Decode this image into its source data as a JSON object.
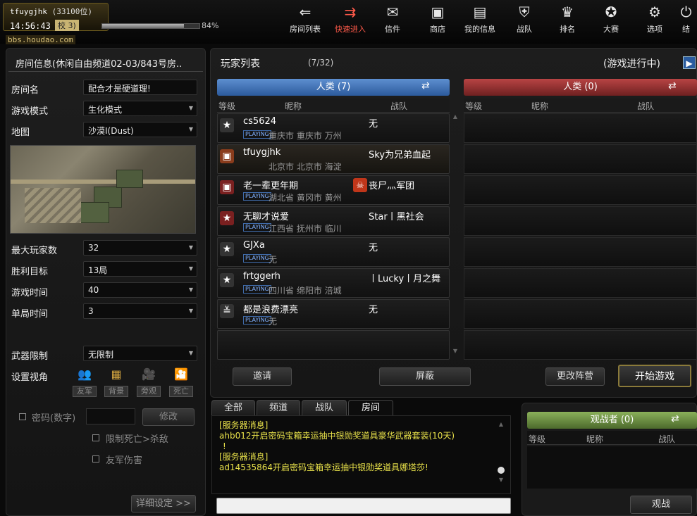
{
  "user": {
    "name": "tfuygjhk",
    "level_text": "(33100位)",
    "clock": "14:56:43",
    "badge": "校 3)",
    "exp_percent": 84,
    "exp_label": "84%",
    "site": "bbs.houdao.com"
  },
  "nav": [
    {
      "label": "房间列表",
      "icon": "back-arrow-icon"
    },
    {
      "label": "快速进入",
      "icon": "fast-forward-icon"
    },
    {
      "label": "信件",
      "icon": "mail-icon"
    },
    {
      "label": "商店",
      "icon": "shop-icon"
    },
    {
      "label": "我的信息",
      "icon": "profile-card-icon"
    },
    {
      "label": "战队",
      "icon": "clan-shield-icon"
    },
    {
      "label": "排名",
      "icon": "trophy-icon"
    },
    {
      "label": "大赛",
      "icon": "medal-icon"
    },
    {
      "label": "选项",
      "icon": "gear-icon"
    },
    {
      "label": "结",
      "icon": "power-icon"
    }
  ],
  "room": {
    "title": "房间信息(休闲自由频道02-03/843号房..",
    "name_label": "房间名",
    "name_value": "配合才是硬道理!",
    "mode_label": "游戏模式",
    "mode_value": "生化模式",
    "map_label": "地图",
    "map_value": "沙漠Ⅰ(Dust)",
    "max_label": "最大玩家数",
    "max_value": "32",
    "win_label": "胜利目标",
    "win_value": "13局",
    "time_label": "游戏时间",
    "time_value": "40",
    "round_label": "单局时间",
    "round_value": "3",
    "weapon_label": "武器限制",
    "weapon_value": "无限制",
    "view_label": "设置视角",
    "views": [
      "友军",
      "背景",
      "旁观",
      "死亡"
    ],
    "password_label": "密码(数字)",
    "modify_btn": "修改",
    "opt1": "限制死亡>杀敌",
    "opt2": "友军伤害",
    "detail_btn": "详细设定 >>"
  },
  "players": {
    "title": "玩家列表",
    "count": "(7/32)",
    "status": "(游戏进行中)",
    "team_a": "人类 (7)",
    "team_b": "人类 (0)",
    "col_rank": "等级",
    "col_name": "昵称",
    "col_clan": "战队",
    "tag": "PLAYING",
    "rows": [
      {
        "name": "cs5624",
        "loc": "重庆市 重庆市 万州",
        "clan": "无"
      },
      {
        "name": "tfuygjhk",
        "loc": "北京市 北京市 海淀",
        "clan": "Sky为兄弟血起"
      },
      {
        "name": "老一辈更年期",
        "loc": "湖北省 黄冈市 黄州",
        "clan": "丧尸灬军团"
      },
      {
        "name": "无聊才说爱",
        "loc": "江西省 抚州市 临川",
        "clan": "Star丨黑社会"
      },
      {
        "name": "GJXa",
        "loc": "无",
        "clan": "无"
      },
      {
        "name": "frtggerh",
        "loc": "四川省 绵阳市 涪城",
        "clan": "丨Lucky丨月之舞"
      },
      {
        "name": "都是浪费漂亮",
        "loc": "无",
        "clan": "无"
      }
    ],
    "invite_btn": "邀请",
    "block_btn": "屏蔽",
    "switch_btn": "更改阵营",
    "start_btn": "开始游戏"
  },
  "chat": {
    "tabs": [
      "全部",
      "频道",
      "战队",
      "房间"
    ],
    "lines": [
      "[服务器消息]",
      "ahb012开启密码宝箱幸运抽中银勋奖道具豪华武器套装(10天)",
      "!",
      "[服务器消息]",
      "ad14535864开启密码宝箱幸运抽中银勋奖道具娜塔莎!"
    ]
  },
  "spectators": {
    "title": "观战者 (0)",
    "col_rank": "等级",
    "col_name": "昵称",
    "col_clan": "战队",
    "spectate_btn": "观战"
  },
  "colors": {
    "team_blue": "#3f6aa8",
    "team_red": "#8c2a2a",
    "spec_green": "#5d7a3a",
    "chat_yellow": "#e8e14a",
    "active_red": "#ff5a4a"
  }
}
